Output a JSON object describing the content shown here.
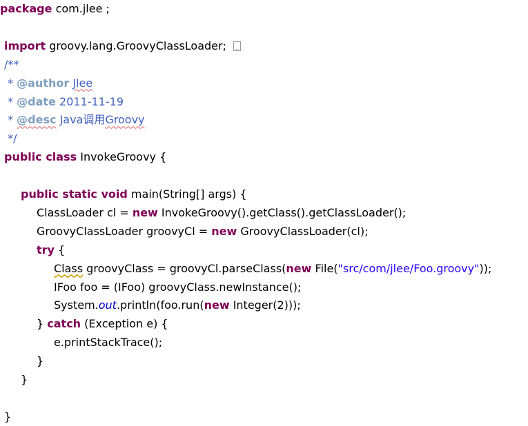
{
  "colors": {
    "keyword": "#7f0055",
    "comment": "#3f5fbf",
    "javadoc_tag": "#7f9fbf",
    "string": "#2a00ff",
    "field": "#0000c0"
  },
  "lines": [
    {
      "indent": 0,
      "tokens": [
        {
          "t": "package",
          "c": "kw"
        },
        {
          "t": " com.jlee ;",
          "c": "plain"
        }
      ]
    },
    {
      "indent": 0,
      "tokens": []
    },
    {
      "indent": 0,
      "fold": true,
      "tokens": [
        {
          "t": "import",
          "c": "kw"
        },
        {
          "t": " groovy.lang.GroovyClassLoader;",
          "c": "plain"
        }
      ]
    },
    {
      "indent": 0,
      "tokens": [
        {
          "t": "/**",
          "c": "comment"
        }
      ]
    },
    {
      "indent": 0,
      "tokens": [
        {
          "t": " * ",
          "c": "comment"
        },
        {
          "t": "@author",
          "c": "tag"
        },
        {
          "t": " ",
          "c": "comment"
        },
        {
          "t": "Jlee",
          "c": "comment spell"
        }
      ]
    },
    {
      "indent": 0,
      "tokens": [
        {
          "t": " * ",
          "c": "comment"
        },
        {
          "t": "@date",
          "c": "tag"
        },
        {
          "t": " 2011-11-19",
          "c": "comment"
        }
      ]
    },
    {
      "indent": 0,
      "tokens": [
        {
          "t": " * ",
          "c": "comment"
        },
        {
          "t": "@desc",
          "c": "tag spell"
        },
        {
          "t": " Java调用",
          "c": "comment"
        },
        {
          "t": "Groovy",
          "c": "comment spell"
        }
      ]
    },
    {
      "indent": 0,
      "tokens": [
        {
          "t": " */",
          "c": "comment"
        }
      ]
    },
    {
      "indent": 0,
      "tokens": [
        {
          "t": "public class",
          "c": "kw"
        },
        {
          "t": " InvokeGroovy {",
          "c": "plain"
        }
      ]
    },
    {
      "indent": 0,
      "tokens": []
    },
    {
      "indent": 1,
      "tokens": [
        {
          "t": "public static void",
          "c": "kw"
        },
        {
          "t": " main(String[] args) {",
          "c": "plain"
        }
      ]
    },
    {
      "indent": 2,
      "tokens": [
        {
          "t": "ClassLoader cl = ",
          "c": "plain"
        },
        {
          "t": "new",
          "c": "kw"
        },
        {
          "t": " InvokeGroovy().getClass().getClassLoader();",
          "c": "plain"
        }
      ]
    },
    {
      "indent": 2,
      "tokens": [
        {
          "t": "GroovyClassLoader groovyCl = ",
          "c": "plain"
        },
        {
          "t": "new",
          "c": "kw"
        },
        {
          "t": " GroovyClassLoader(cl);",
          "c": "plain"
        }
      ]
    },
    {
      "indent": 2,
      "tokens": [
        {
          "t": "try",
          "c": "kw"
        },
        {
          "t": " {",
          "c": "plain"
        }
      ]
    },
    {
      "indent": 3,
      "tokens": [
        {
          "t": "Class",
          "c": "plain warn"
        },
        {
          "t": " groovyClass = groovyCl.parseClass(",
          "c": "plain"
        },
        {
          "t": "new",
          "c": "kw"
        },
        {
          "t": " File(",
          "c": "plain"
        },
        {
          "t": "\"src/com/jlee/Foo.groovy\"",
          "c": "str"
        },
        {
          "t": "));",
          "c": "plain"
        }
      ]
    },
    {
      "indent": 3,
      "tokens": [
        {
          "t": "IFoo foo = (IFoo) groovyClass.newInstance();",
          "c": "plain"
        }
      ]
    },
    {
      "indent": 3,
      "tokens": [
        {
          "t": "System.",
          "c": "plain"
        },
        {
          "t": "out",
          "c": "field"
        },
        {
          "t": ".println(foo.run(",
          "c": "plain"
        },
        {
          "t": "new",
          "c": "kw"
        },
        {
          "t": " Integer(2)));",
          "c": "plain"
        }
      ]
    },
    {
      "indent": 2,
      "tokens": [
        {
          "t": "} ",
          "c": "plain"
        },
        {
          "t": "catch",
          "c": "kw"
        },
        {
          "t": " (Exception e) {",
          "c": "plain"
        }
      ]
    },
    {
      "indent": 3,
      "tokens": [
        {
          "t": "e.printStackTrace();",
          "c": "plain"
        }
      ]
    },
    {
      "indent": 2,
      "tokens": [
        {
          "t": "}",
          "c": "plain"
        }
      ]
    },
    {
      "indent": 1,
      "tokens": [
        {
          "t": "}",
          "c": "plain"
        }
      ]
    },
    {
      "indent": 0,
      "tokens": []
    },
    {
      "indent": 0,
      "tokens": [
        {
          "t": "}",
          "c": "plain"
        }
      ]
    }
  ]
}
